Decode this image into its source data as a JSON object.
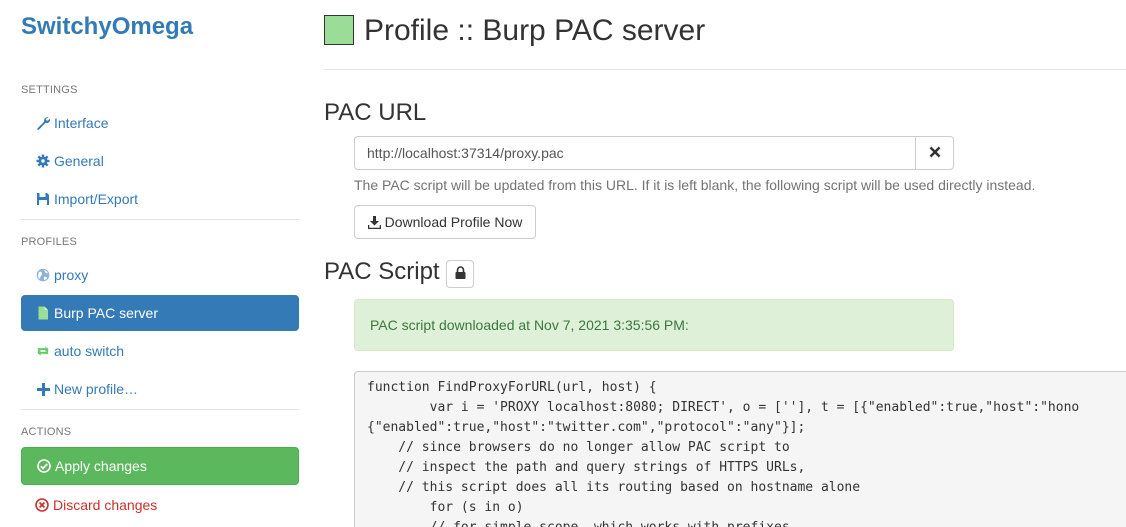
{
  "sidebar": {
    "brand": "SwitchyOmega",
    "settings_header": "SETTINGS",
    "settings_items": [
      {
        "label": "Interface",
        "icon": "wrench-icon"
      },
      {
        "label": "General",
        "icon": "gear-icon"
      },
      {
        "label": "Import/Export",
        "icon": "floppy-disk-icon"
      }
    ],
    "profiles_header": "PROFILES",
    "profiles": [
      {
        "label": "proxy",
        "icon": "globe-icon"
      },
      {
        "label": "Burp PAC server",
        "icon": "file-icon",
        "active": true
      },
      {
        "label": "auto switch",
        "icon": "retweet-icon"
      },
      {
        "label": "New profile…",
        "icon": "plus-icon"
      }
    ],
    "actions_header": "ACTIONS",
    "apply_label": "Apply changes",
    "discard_label": "Discard changes"
  },
  "main": {
    "title": "Profile :: Burp PAC server",
    "swatch_color": "#99dd99",
    "pac_url_heading": "PAC URL",
    "pac_url_value": "http://localhost:37314/proxy.pac",
    "pac_url_help": "The PAC script will be updated from this URL. If it is left blank, the following script will be used directly instead.",
    "download_label": "Download Profile Now",
    "pac_script_heading": "PAC Script",
    "alert_text": "PAC script downloaded at Nov 7, 2021 3:35:56 PM:",
    "code_text": "function FindProxyForURL(url, host) {\n        var i = 'PROXY localhost:8080; DIRECT', o = [''], t = [{\"enabled\":true,\"host\":\"hono\n{\"enabled\":true,\"host\":\"twitter.com\",\"protocol\":\"any\"}];\n    // since browsers do no longer allow PAC script to\n    // inspect the path and query strings of HTTPS URLs,\n    // this script does all its routing based on hostname alone\n        for (s in o)\n        // for simple scope, which works with prefixes"
  },
  "colors": {
    "link": "#337ab7",
    "success": "#5cb85c",
    "danger": "#c9302c",
    "alert_bg": "#dff0d8"
  }
}
